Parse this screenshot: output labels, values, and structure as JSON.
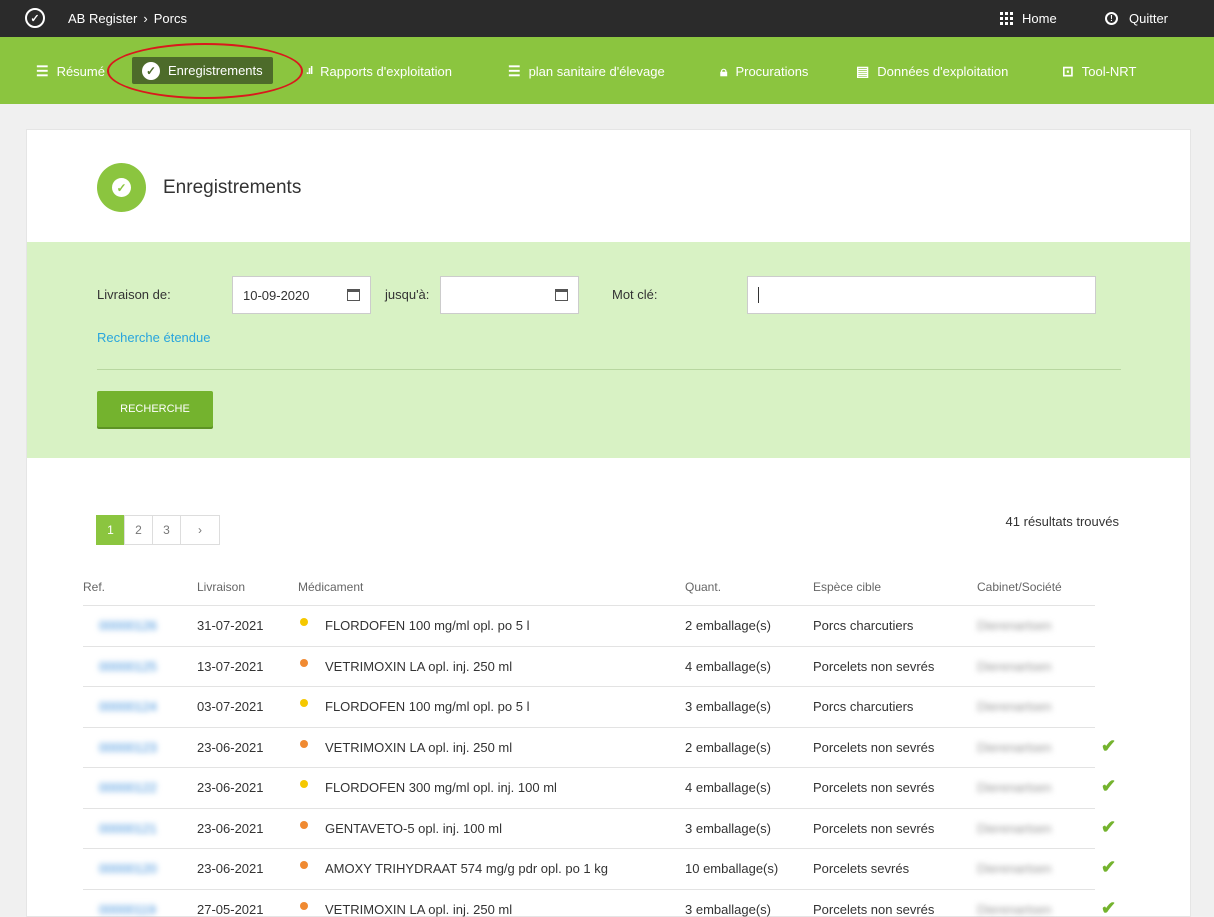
{
  "topbar": {
    "breadcrumb": [
      "AB Register",
      "›",
      "Porcs"
    ],
    "home_label": "Home",
    "quit_label": "Quitter",
    "logo_icon": "check-circle-icon"
  },
  "nav": {
    "items": [
      {
        "label": "Résumé",
        "icon": "list-icon"
      },
      {
        "label": "Enregistrements",
        "icon": "check-circle-icon",
        "active": true
      },
      {
        "label": "Rapports d'exploitation",
        "icon": "bar-chart-icon"
      },
      {
        "label": "plan sanitaire d'élevage",
        "icon": "checklist-icon"
      },
      {
        "label": "Procurations",
        "icon": "lock-icon"
      },
      {
        "label": "Données d'exploitation",
        "icon": "document-icon"
      },
      {
        "label": "Tool-NRT",
        "icon": "line-chart-icon"
      }
    ],
    "highlight_color": "#d9191c"
  },
  "page": {
    "title": "Enregistrements"
  },
  "filter": {
    "delivery_from_label": "Livraison de:",
    "delivery_from_value": "10-09-2020",
    "until_label": "jusqu'à:",
    "until_value": "",
    "keyword_label": "Mot clé:",
    "keyword_value": "",
    "advanced_link": "Recherche étendue",
    "search_button": "RECHERCHE"
  },
  "pagination": {
    "pages": [
      "1",
      "2",
      "3",
      "›"
    ],
    "active": "1"
  },
  "results_count": "41 résultats trouvés",
  "table": {
    "headers": {
      "ref": "Ref.",
      "delivery": "Livraison",
      "medicine": "Médicament",
      "quantity": "Quant.",
      "species": "Espèce cible",
      "company": "Cabinet/Société"
    },
    "rows": [
      {
        "ref": "00000126",
        "date": "31-07-2021",
        "dot": "#f5c800",
        "medicine": "FLORDOFEN 100 mg/ml opl. po 5 l",
        "qty": "2 emballage(s)",
        "species": "Porcs charcutiers",
        "company": "Dierenartsen",
        "check": ""
      },
      {
        "ref": "00000125",
        "date": "13-07-2021",
        "dot": "#f08a32",
        "medicine": "VETRIMOXIN LA opl. inj. 250 ml",
        "qty": "4 emballage(s)",
        "species": "Porcelets non sevrés",
        "company": "Dierenartsen",
        "check": ""
      },
      {
        "ref": "00000124",
        "date": "03-07-2021",
        "dot": "#f5c800",
        "medicine": "FLORDOFEN 100 mg/ml opl. po 5 l",
        "qty": "3 emballage(s)",
        "species": "Porcs charcutiers",
        "company": "Dierenartsen",
        "check": ""
      },
      {
        "ref": "00000123",
        "date": "23-06-2021",
        "dot": "#f08a32",
        "medicine": "VETRIMOXIN LA opl. inj. 250 ml",
        "qty": "2 emballage(s)",
        "species": "Porcelets non sevrés",
        "company": "Dierenartsen",
        "check": "✔"
      },
      {
        "ref": "00000122",
        "date": "23-06-2021",
        "dot": "#f5c800",
        "medicine": "FLORDOFEN 300 mg/ml opl. inj. 100 ml",
        "qty": "4 emballage(s)",
        "species": "Porcelets non sevrés",
        "company": "Dierenartsen",
        "check": "✔"
      },
      {
        "ref": "00000121",
        "date": "23-06-2021",
        "dot": "#f08a32",
        "medicine": "GENTAVETO-5 opl. inj. 100 ml",
        "qty": "3 emballage(s)",
        "species": "Porcelets non sevrés",
        "company": "Dierenartsen",
        "check": "✔"
      },
      {
        "ref": "00000120",
        "date": "23-06-2021",
        "dot": "#f08a32",
        "medicine": "AMOXY TRIHYDRAAT 574 mg/g pdr opl. po 1 kg",
        "qty": "10 emballage(s)",
        "species": "Porcelets sevrés",
        "company": "Dierenartsen",
        "check": "✔"
      },
      {
        "ref": "00000119",
        "date": "27-05-2021",
        "dot": "#f08a32",
        "medicine": "VETRIMOXIN LA opl. inj. 250 ml",
        "qty": "3 emballage(s)",
        "species": "Porcelets non sevrés",
        "company": "Dierenartsen",
        "check": "✔"
      }
    ]
  }
}
